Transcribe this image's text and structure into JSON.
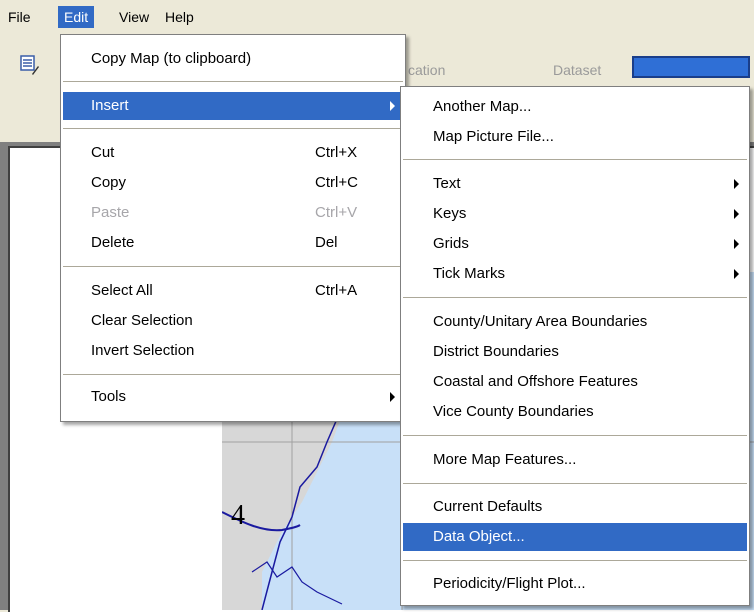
{
  "menubar": {
    "items": [
      {
        "label": "File"
      },
      {
        "label": "Edit"
      },
      {
        "label": "View"
      },
      {
        "label": "Help"
      }
    ]
  },
  "toolbar": {
    "location_label": "cation",
    "dataset_label": "Dataset"
  },
  "map": {
    "grid_number": "4"
  },
  "edit_menu": {
    "copy_map": "Copy Map (to clipboard)",
    "insert": "Insert",
    "cut": {
      "label": "Cut",
      "shortcut": "Ctrl+X"
    },
    "copy": {
      "label": "Copy",
      "shortcut": "Ctrl+C"
    },
    "paste": {
      "label": "Paste",
      "shortcut": "Ctrl+V"
    },
    "delete": {
      "label": "Delete",
      "shortcut": "Del"
    },
    "select_all": {
      "label": "Select All",
      "shortcut": "Ctrl+A"
    },
    "clear_selection": "Clear Selection",
    "invert_selection": "Invert Selection",
    "tools": "Tools"
  },
  "insert_menu": {
    "another_map": "Another Map...",
    "map_picture_file": "Map Picture File...",
    "text": "Text",
    "keys": "Keys",
    "grids": "Grids",
    "tick_marks": "Tick Marks",
    "county_boundaries": "County/Unitary Area Boundaries",
    "district_boundaries": "District Boundaries",
    "coastal_features": "Coastal and Offshore Features",
    "vice_county": "Vice County Boundaries",
    "more_map_features": "More Map Features...",
    "current_defaults": "Current Defaults",
    "data_object": "Data Object...",
    "periodicity": "Periodicity/Flight Plot..."
  },
  "colors": {
    "highlight": "#316ac5",
    "menu_bg": "#ffffff",
    "window_bg": "#ece9d8",
    "map_sea": "#c8e0f8",
    "map_land": "#d7d7d7",
    "coastline": "#1a1aa0"
  }
}
